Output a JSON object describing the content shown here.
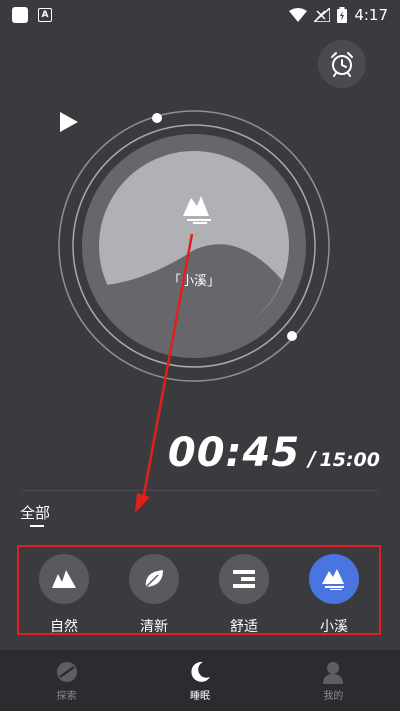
{
  "status_bar": {
    "time": "4:17"
  },
  "player": {
    "track_label": "「小溪」"
  },
  "timer": {
    "elapsed": "00:45",
    "separator": "/",
    "total": "15:00"
  },
  "category": {
    "label": "全部"
  },
  "sounds": [
    {
      "label": "自然",
      "icon": "mountains-icon",
      "active": false
    },
    {
      "label": "清新",
      "icon": "leaf-icon",
      "active": false
    },
    {
      "label": "舒适",
      "icon": "lines-icon",
      "active": false
    },
    {
      "label": "小溪",
      "icon": "stream-icon",
      "active": true
    }
  ],
  "nav": [
    {
      "label": "探索",
      "icon": "explore-icon",
      "active": false
    },
    {
      "label": "睡眠",
      "icon": "moon-icon",
      "active": true
    },
    {
      "label": "我的",
      "icon": "profile-icon",
      "active": false
    }
  ],
  "colors": {
    "background": "#3b3b3f",
    "active_sound": "#4a74e0",
    "highlight_box": "#e0201d",
    "annotation_arrow": "#e0201d"
  }
}
